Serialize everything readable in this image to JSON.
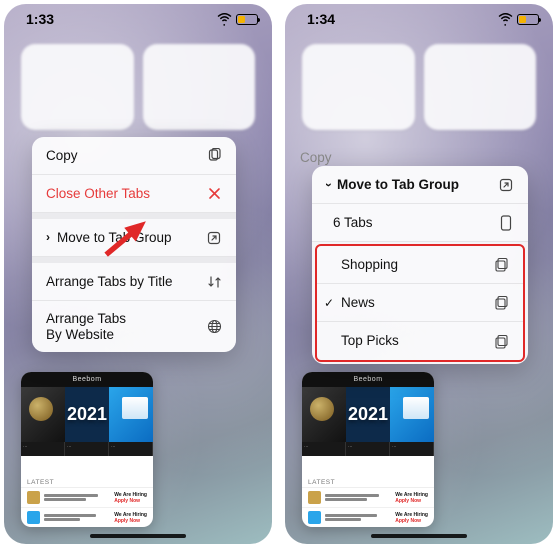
{
  "colors": {
    "destructive": "#e63b3b",
    "accent_border": "#e02828",
    "battery_fill": "#f5b301"
  },
  "left": {
    "time": "1:33",
    "battery_pct": 38,
    "menu": [
      {
        "label": "Copy",
        "icon": "copy"
      },
      {
        "label": "Close Other Tabs",
        "icon": "close",
        "destructive": true
      },
      {
        "sep": true
      },
      {
        "label": "Move to Tab Group",
        "icon": "open",
        "leading_chevron": true
      },
      {
        "sep": true
      },
      {
        "label": "Arrange Tabs by Title",
        "icon": "sort"
      },
      {
        "label": "Arrange Tabs\nBy Website",
        "icon": "globe"
      }
    ]
  },
  "right": {
    "time": "1:34",
    "battery_pct": 38,
    "faded_item": "Copy",
    "header": {
      "label": "Move to Tab Group",
      "icon": "open",
      "leading_chevron_down": true
    },
    "current": {
      "label": "6 Tabs",
      "icon": "device"
    },
    "groups": [
      {
        "label": "Shopping",
        "icon": "stack"
      },
      {
        "label": "News",
        "icon": "stack",
        "checked": true
      },
      {
        "label": "Top Picks",
        "icon": "stack"
      }
    ]
  },
  "thumb": {
    "site": "Beebom",
    "year": "2021",
    "latest": "LATEST",
    "rows": [
      {
        "color": "#caa24a",
        "hire": "We Are Hiring",
        "apply": "Apply Now"
      },
      {
        "color": "#2aa5ea",
        "hire": "We Are Hiring",
        "apply": "Apply Now"
      }
    ]
  }
}
